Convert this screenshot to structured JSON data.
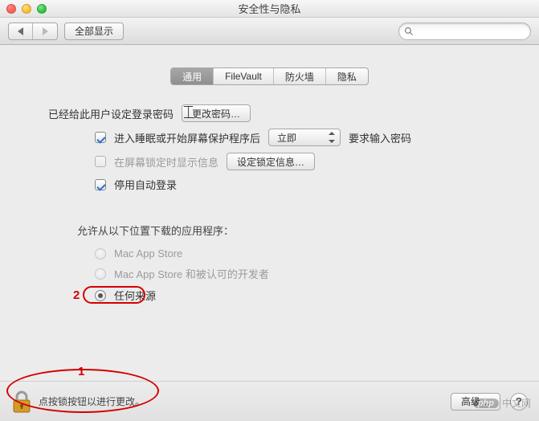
{
  "window": {
    "title": "安全性与隐私"
  },
  "toolbar": {
    "show_all": "全部显示",
    "search_placeholder": ""
  },
  "tabs": [
    "通用",
    "FileVault",
    "防火墙",
    "隐私"
  ],
  "general": {
    "password_set_text": "已经给此用户设定登录密码",
    "change_password_btn": "更改密码…",
    "opt_sleep_require_pw_prefix": "进入睡眠或开始屏幕保护程序后",
    "opt_sleep_require_pw_suffix": "要求输入密码",
    "delay_selected": "立即",
    "opt_show_message": "在屏幕锁定时显示信息",
    "set_lock_message_btn": "设定锁定信息…",
    "opt_disable_autologin": "停用自动登录",
    "allow_apps_title": "允许从以下位置下载的应用程序：",
    "radio_appstore": "Mac App Store",
    "radio_identified": "Mac App Store 和被认可的开发者",
    "radio_anywhere": "任何来源"
  },
  "footer": {
    "lock_msg": "点按锁按钮以进行更改。",
    "advanced_btn": "高级…",
    "help_label": "?"
  },
  "annotations": {
    "num1": "1",
    "num2": "2"
  },
  "watermark": {
    "logo": "php",
    "text": "中文网"
  }
}
